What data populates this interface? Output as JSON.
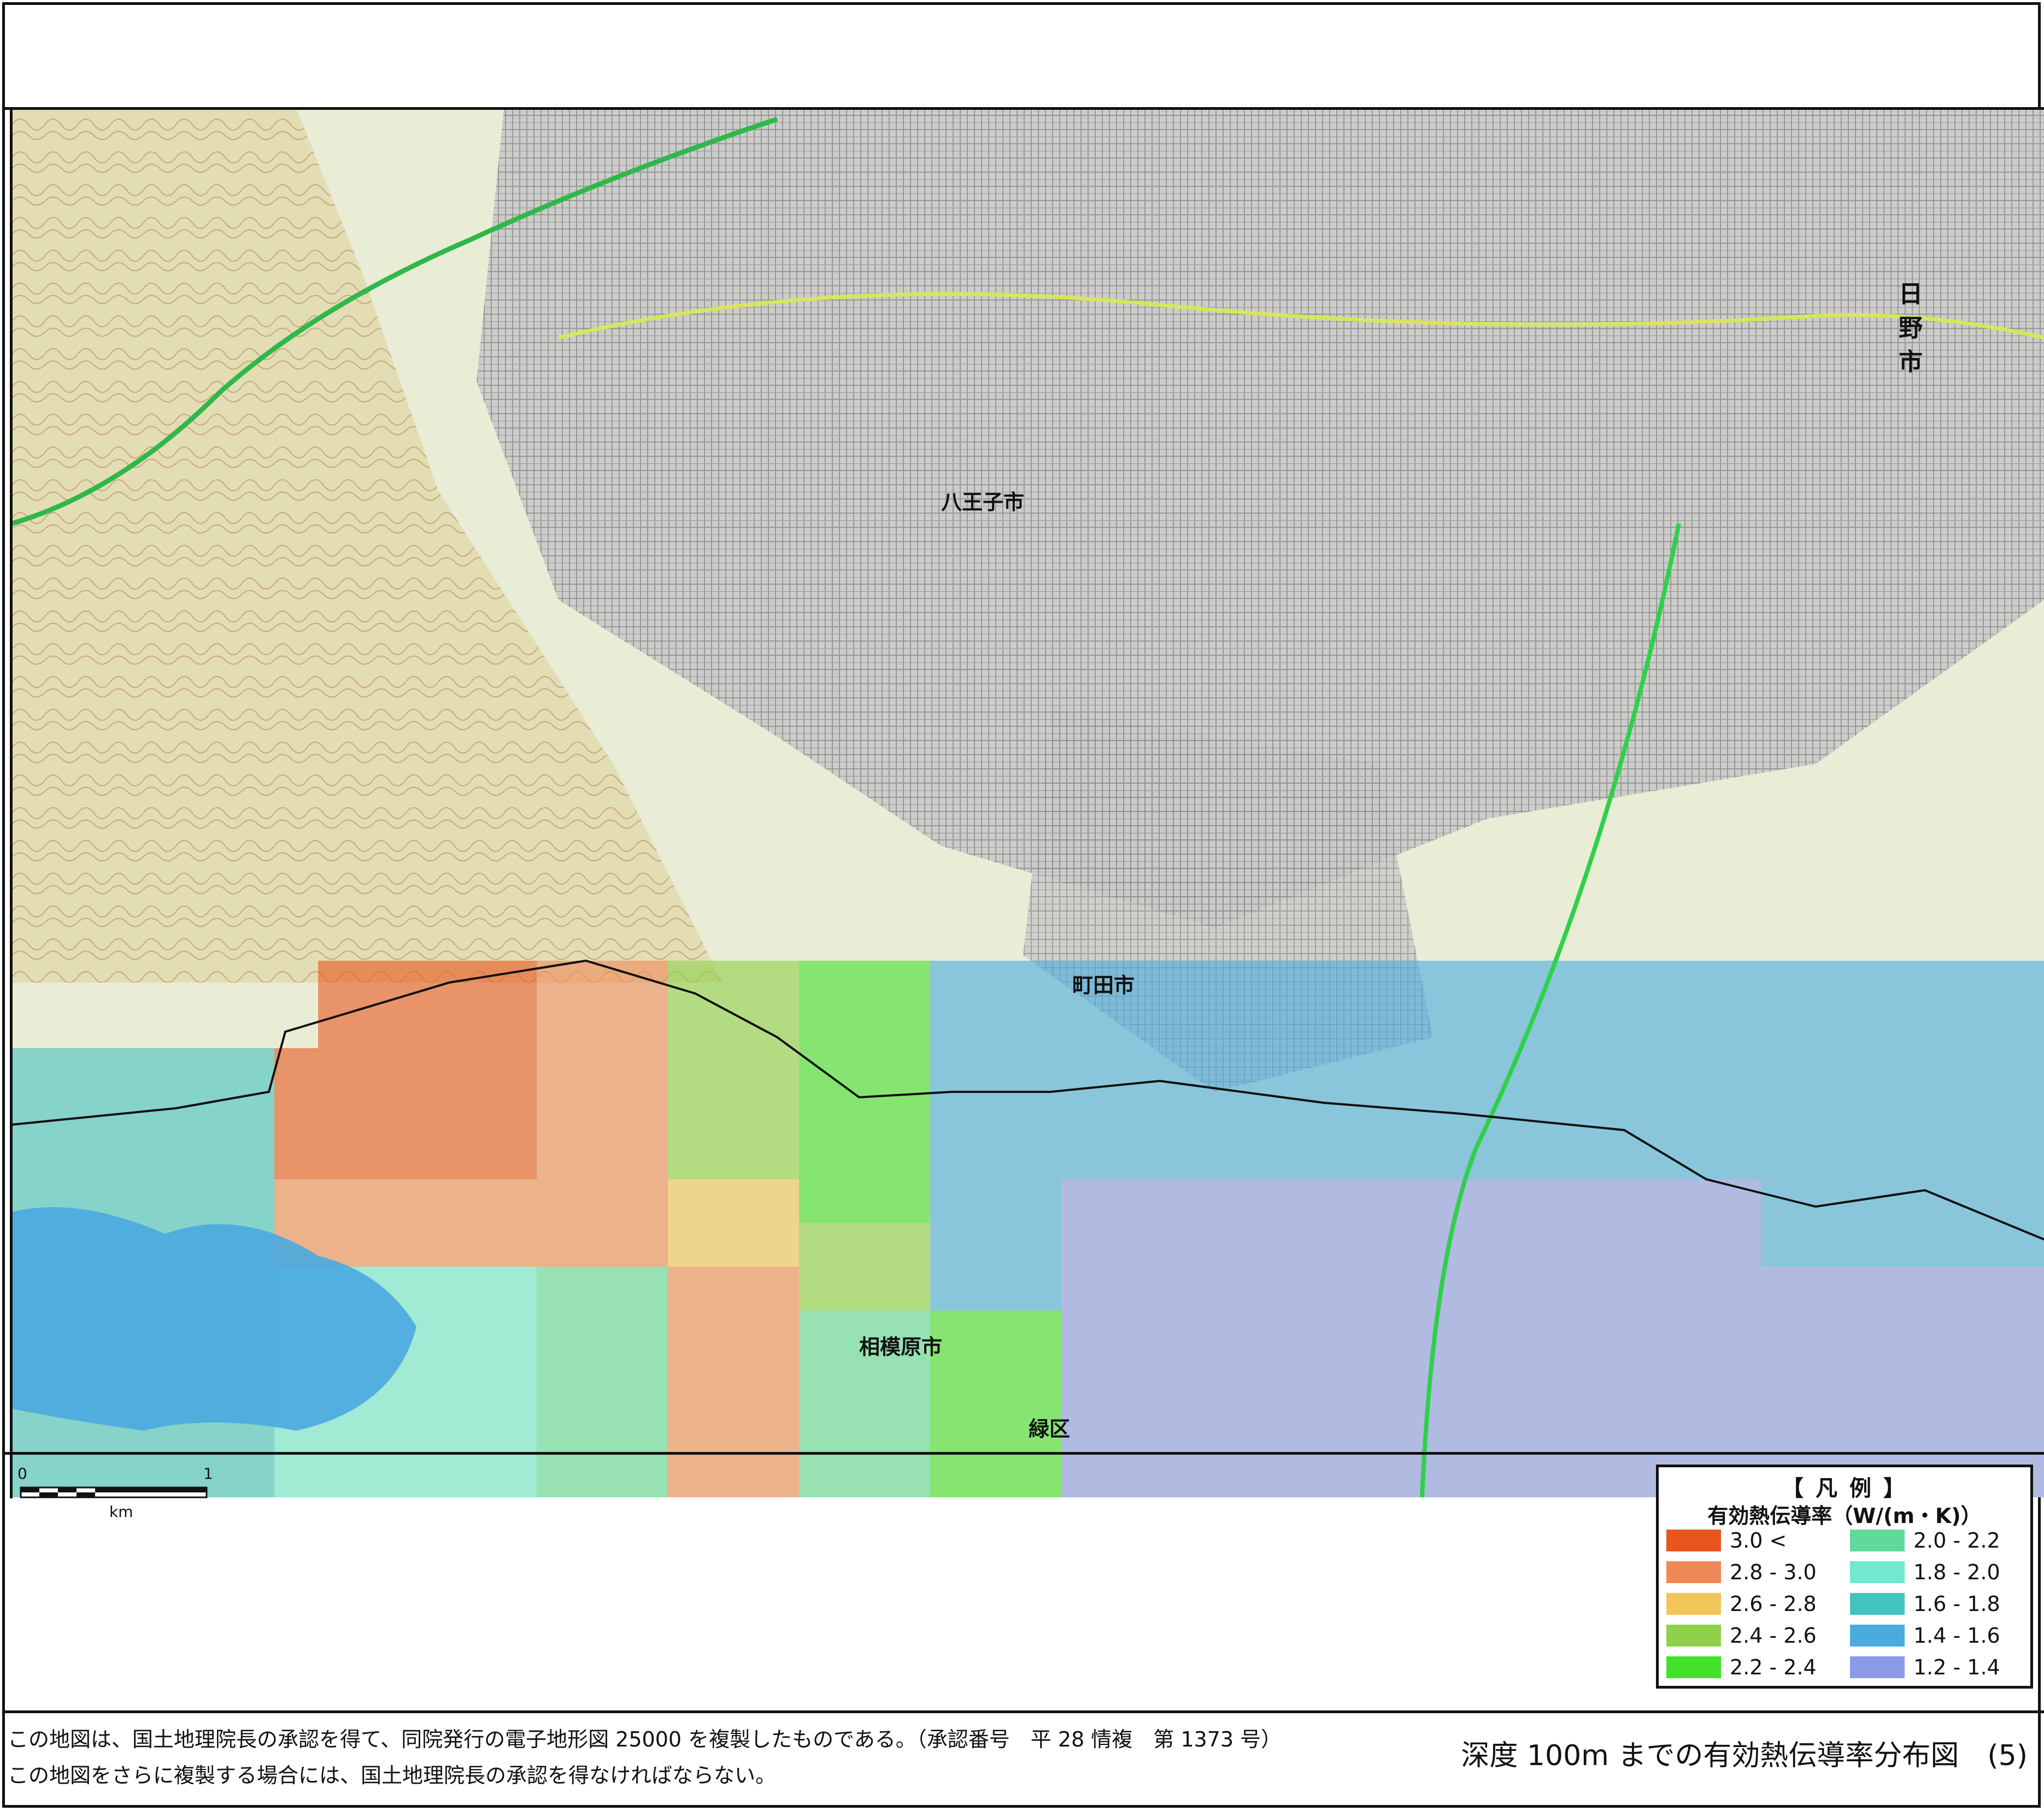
{
  "map": {
    "city_labels": {
      "hachioji": "八王子市",
      "machida": "町田市",
      "sagamihara": "相模原市",
      "hino": "日野市",
      "midori": "緑区"
    }
  },
  "scale_bar": {
    "zero": "0",
    "one": "1",
    "unit": "km"
  },
  "legend": {
    "title": "【 凡 例 】",
    "heading": "有効熱伝導率（W/(m・K)）",
    "items": [
      {
        "label": "3.0 <",
        "color": "#e8561e"
      },
      {
        "label": "2.8 - 3.0",
        "color": "#ef8a58"
      },
      {
        "label": "2.6 - 2.8",
        "color": "#f1c55a"
      },
      {
        "label": "2.4 - 2.6",
        "color": "#8fd14a"
      },
      {
        "label": "2.2 - 2.4",
        "color": "#44e02c"
      },
      {
        "label": "2.0 - 2.2",
        "color": "#61d99a"
      },
      {
        "label": "1.8 - 2.0",
        "color": "#71e8d0"
      },
      {
        "label": "1.6 - 1.8",
        "color": "#44c2c0"
      },
      {
        "label": "1.4 - 1.6",
        "color": "#4aabdf"
      },
      {
        "label": "1.2 - 1.4",
        "color": "#8c9ae8"
      }
    ]
  },
  "footer": {
    "credit_line1": "この地図は、国土地理院長の承認を得て、同院発行の電子地形図 25000 を複製したものである。（承認番号　平 28 情複　第 1373 号）",
    "credit_line2": "この地図をさらに複製する場合には、国土地理院長の承認を得なければならない。",
    "title": "深度 100m までの有効熱伝導率分布図　(5)"
  }
}
